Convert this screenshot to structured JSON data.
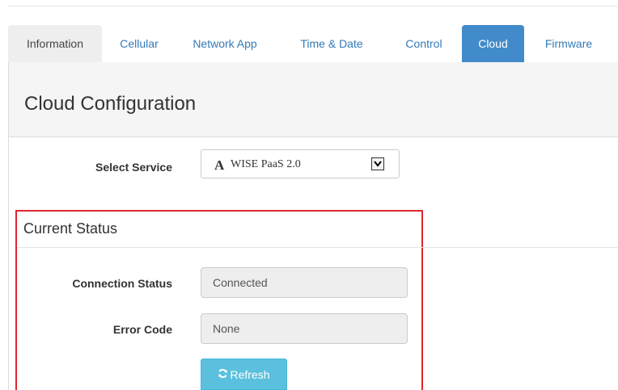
{
  "tabs": [
    {
      "label": "Information",
      "state": "default"
    },
    {
      "label": "Cellular",
      "state": "link"
    },
    {
      "label": "Network App",
      "state": "link"
    },
    {
      "label": "Time & Date",
      "state": "link"
    },
    {
      "label": "Control",
      "state": "link"
    },
    {
      "label": "Cloud",
      "state": "active"
    },
    {
      "label": "Firmware",
      "state": "link"
    }
  ],
  "panel": {
    "title": "Cloud Configuration"
  },
  "service": {
    "label": "Select Service",
    "selected": "WISE PaaS 2.0",
    "icon_glyph": "A"
  },
  "status": {
    "title": "Current Status",
    "connection_label": "Connection Status",
    "connection_value": "Connected",
    "error_label": "Error Code",
    "error_value": "None",
    "refresh_label": "Refresh"
  },
  "colors": {
    "accent": "#428bca",
    "link": "#337ab7",
    "info_button": "#5bc0de",
    "highlight_border": "#e0262f"
  },
  "icons": {
    "refresh": "refresh-icon",
    "dropdown": "chevron-down-icon"
  }
}
